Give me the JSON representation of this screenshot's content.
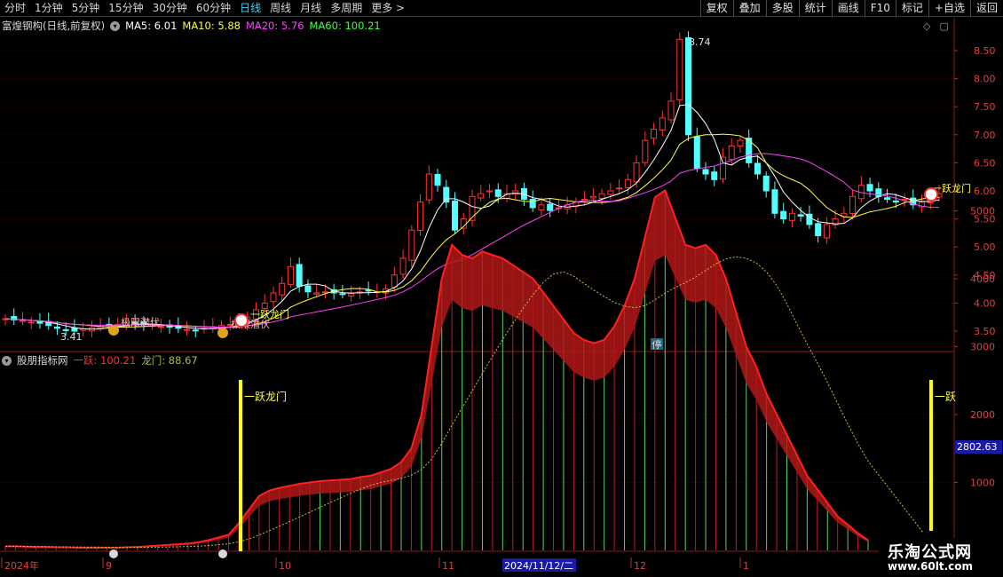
{
  "toolbar": {
    "periods": [
      "分时",
      "1分钟",
      "5分钟",
      "15分钟",
      "30分钟",
      "60分钟",
      "日线",
      "周线",
      "月线",
      "多周期",
      "更多"
    ],
    "active_period": "日线",
    "more_arrow": ">",
    "buttons": [
      "复权",
      "叠加",
      "多股",
      "统计",
      "画线",
      "F10",
      "标记",
      "+自选",
      "返回"
    ]
  },
  "main": {
    "title": "富煌钢构(日线,前复权)",
    "ma5": "MA5: 6.01",
    "ma10": "MA10: 5.88",
    "ma20": "MA20: 5.76",
    "ma60": "MA60: 100.21",
    "colors": {
      "ma5": "#ffffff",
      "ma10": "#ffff40",
      "ma20": "#ff40ff",
      "ma60": "#40ff40",
      "up": "#ff3232",
      "down": "#54ffff"
    },
    "y_ticks": [
      "8.50",
      "8.00",
      "7.50",
      "7.00",
      "6.50",
      "6.00",
      "5.50",
      "5.00",
      "4.50",
      "4.00",
      "3.50"
    ],
    "high_label": "8.74",
    "low_label": "3.41",
    "stop_badge": "停",
    "signal_labels": [
      "一跃龙门",
      "极限潜伏",
      "极限潜伏",
      "一跃龙门"
    ]
  },
  "sub": {
    "title": "股朋指标网",
    "line1": "一跃: 100.21",
    "line2": "龙门: 88.67",
    "colors": {
      "line1": "#ff3030",
      "line2": "#a0c040"
    },
    "y_ticks": [
      "5000",
      "4000",
      "3000",
      "2000",
      "1000"
    ],
    "current_value": "2802.63",
    "marker_labels": [
      "一跃龙门",
      "一跃"
    ]
  },
  "xaxis": {
    "labels": [
      "2024年",
      "9",
      "10",
      "11",
      "12",
      "1"
    ],
    "cursor_date": "2024/11/12/二"
  },
  "watermark": {
    "line1": "乐淘公式网",
    "line2": "www.60lt.com"
  },
  "icons": [
    "diamond-icon",
    "window-icon"
  ]
}
